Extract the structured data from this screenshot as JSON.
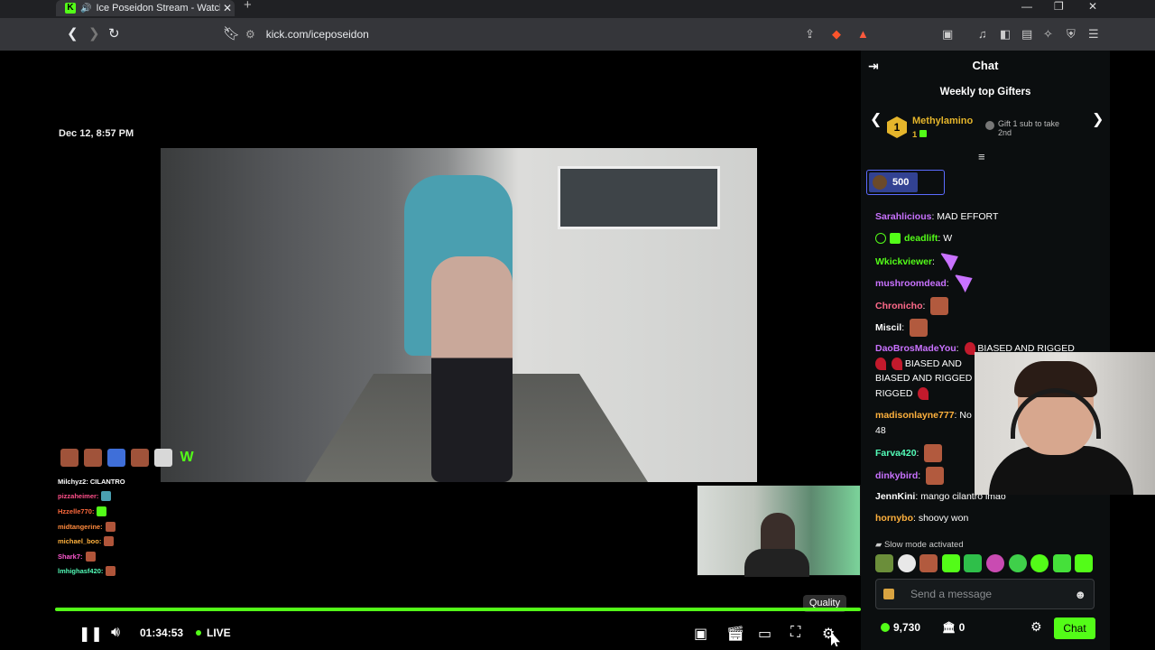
{
  "browser": {
    "tab_title": "Ice Poseidon Stream - Watch",
    "url": "kick.com/iceposeidon"
  },
  "stream": {
    "date": "Dec 12, 8:57 PM",
    "elapsed": "01:34:53",
    "live_label": "LIVE",
    "quality_tooltip": "Quality",
    "progress_fraction": 1.0
  },
  "overlay_chat": [
    {
      "user": "Milchyz2:",
      "text": "CILANTRO",
      "color": "#ffffff"
    },
    {
      "user": "pizzaheimer:",
      "text": "",
      "color": "#ff4f8a"
    },
    {
      "user": "Hzzelle770:",
      "text": "",
      "color": "#ff6a3d"
    },
    {
      "user": "midtangerine:",
      "text": "",
      "color": "#ff8a3d"
    },
    {
      "user": "michael_boo:",
      "text": "",
      "color": "#ffb13d"
    },
    {
      "user": "Shark7:",
      "text": "",
      "color": "#ff5ad1"
    },
    {
      "user": "lmhighasf420:",
      "text": "",
      "color": "#53fcb8"
    }
  ],
  "chat": {
    "title": "Chat",
    "gifters_title": "Weekly top Gifters",
    "top_gifter": {
      "rank": "1",
      "name": "Methylamino",
      "count": "1"
    },
    "gift_hint": "Gift 1 sub to take 2nd",
    "pinned_amount": "500",
    "messages": [
      {
        "user": "Sarahlicious",
        "text": "MAD EFFORT",
        "color": "#c972ff"
      },
      {
        "user": "deadlift",
        "text": "W",
        "color": "#53fc18"
      },
      {
        "user": "Wkickviewer",
        "text": "",
        "color": "#53fc18"
      },
      {
        "user": "mushroomdead",
        "text": "",
        "color": "#c972ff"
      },
      {
        "user": "Chronicho",
        "text": "",
        "color": "#ff6a8a"
      },
      {
        "user": "Miscil",
        "text": "",
        "color": "#ffffff"
      },
      {
        "user": "DaoBrosMadeYou",
        "text": "BIASED AND RIGGED",
        "line2": "BIASED AND",
        "line3": "BIASED AND RIGGED",
        "line4": "RIGGED",
        "color": "#c972ff"
      },
      {
        "user": "madisonlayne777",
        "text": "No",
        "line2": "48",
        "color": "#ffb13d"
      },
      {
        "user": "Farva420",
        "text": "",
        "color": "#53fcb8"
      },
      {
        "user": "dinkybird",
        "text": "",
        "color": "#c972ff"
      },
      {
        "user": "JennKini",
        "text": "mango cilantro lmao",
        "color": "#ffffff"
      },
      {
        "user": "hornybo",
        "text": "shoovy won",
        "color": "#ffb13d"
      }
    ],
    "slow_mode": "Slow mode activated",
    "input_placeholder": "Send a message",
    "points": "9,730",
    "bank_count": "0",
    "chat_button": "Chat"
  },
  "icons": [
    "back-icon",
    "forward-icon",
    "reload-icon",
    "bookmark-icon",
    "share-icon",
    "pause-icon",
    "volume-icon",
    "miniplayer-icon",
    "theater-icon",
    "fullscreen-icon",
    "gear-icon"
  ],
  "colors": {
    "accent": "#53fc18",
    "gold": "#e5b52b"
  }
}
